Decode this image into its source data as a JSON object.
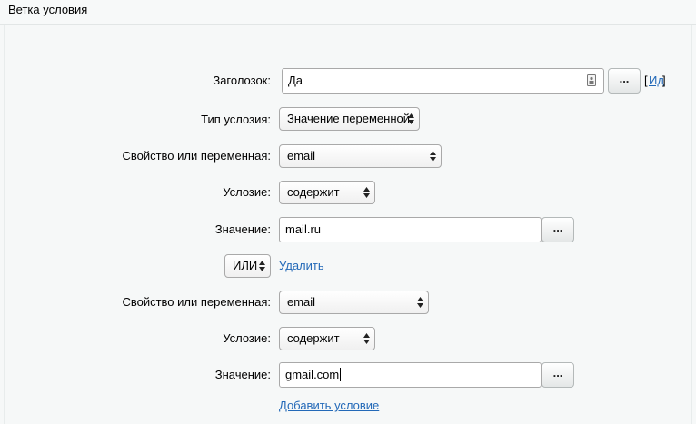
{
  "header": {
    "title": "Ветка условия"
  },
  "form": {
    "title_label": "Заголозок:",
    "title_value": "Да",
    "title_browse": "...",
    "title_id_open": "[",
    "title_id_link": "Ид",
    "title_id_close": "]",
    "condition_type_label": "Тип услозия:",
    "condition_type_value": "Значение переменной",
    "block1": {
      "property_label": "Свойство или переменная:",
      "property_value": "email",
      "condition_label": "Услозие:",
      "condition_value": "содержит",
      "value_label": "Значение:",
      "value_value": "mail.ru",
      "value_browse": "..."
    },
    "operator_value": "ИЛИ",
    "delete_link": "Удалить",
    "block2": {
      "property_label": "Свойство или переменная:",
      "property_value": "email",
      "condition_label": "Услозие:",
      "condition_value": "содержит",
      "value_label": "Значение:",
      "value_value": "gmail.com",
      "value_browse": "..."
    },
    "add_condition_link": "Добавить условие"
  }
}
